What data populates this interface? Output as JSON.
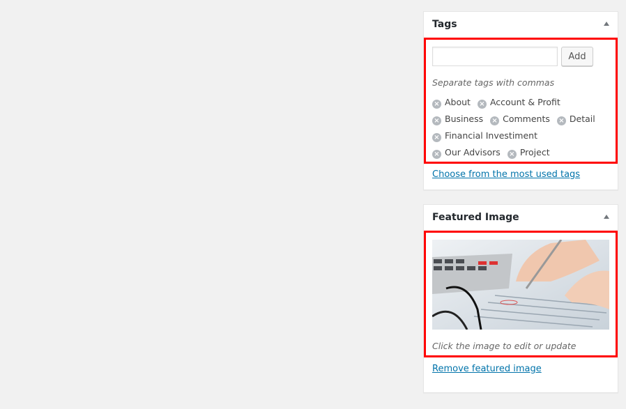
{
  "tags_box": {
    "title": "Tags",
    "input_value": "",
    "add_label": "Add",
    "hint": "Separate tags with commas",
    "tags": [
      "About",
      "Account & Profit",
      "Business",
      "Comments",
      "Detail",
      "Financial Investiment",
      "Our Advisors",
      "Project"
    ],
    "most_used_link": "Choose from the most used tags"
  },
  "featured_box": {
    "title": "Featured Image",
    "caption": "Click the image to edit or update",
    "remove_link": "Remove featured image"
  }
}
